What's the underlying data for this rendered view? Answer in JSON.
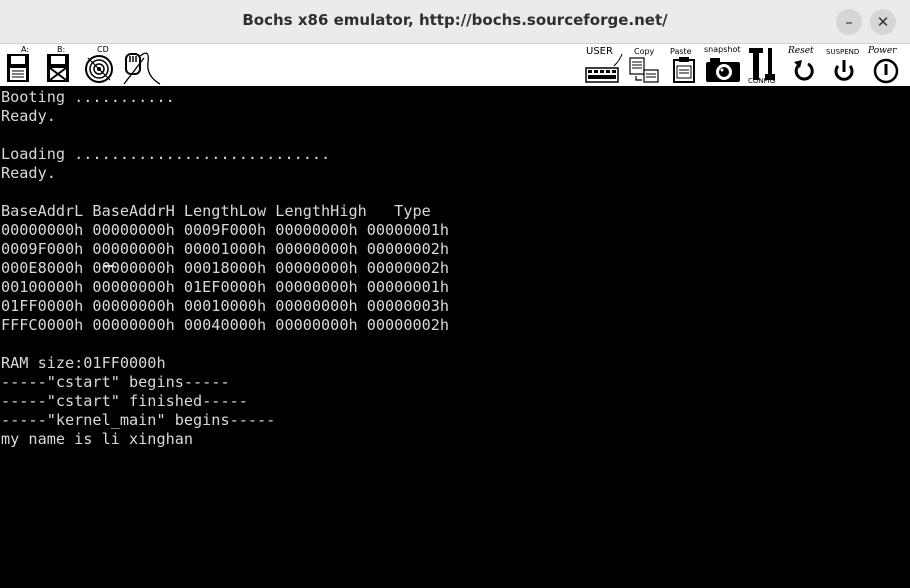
{
  "window": {
    "title": "Bochs x86 emulator, http://bochs.sourceforge.net/",
    "minimize_symbol": "–",
    "close_symbol": "✕"
  },
  "toolbar": {
    "floppy_a": "A:",
    "floppy_b": "B:",
    "cdrom": "CD",
    "user": "USER",
    "copy": "Copy",
    "paste": "Paste",
    "snapshot": "snapshot",
    "config": "CONFIG",
    "reset": "Reset",
    "suspend": "SUSPEND",
    "power": "Power",
    "icons": [
      "floppy-a-icon",
      "floppy-b-icon",
      "cdrom-icon",
      "mouse-icon",
      "keyboard-icon",
      "copy-icon",
      "paste-icon",
      "snapshot-camera-icon",
      "config-icon",
      "reset-icon",
      "suspend-icon",
      "power-icon"
    ]
  },
  "console": {
    "lines": [
      "Booting ...........",
      "Ready.",
      "",
      "Loading ............................",
      "Ready.",
      "",
      "BaseAddrL BaseAddrH LengthLow LengthHigh   Type",
      "00000000h 00000000h 0009F000h 00000000h 00000001h",
      "0009F000h 00000000h 00001000h 00000000h 00000002h",
      "000E8000h 00000000h 00018000h 00000000h 00000002h",
      "00100000h 00000000h 01EF0000h 00000000h 00000001h",
      "01FF0000h 00000000h 00010000h 00000000h 00000003h",
      "FFFC0000h 00000000h 00040000h 00000000h 00000002h",
      "",
      "RAM size:01FF0000h",
      "-----\"cstart\" begins-----",
      "-----\"cstart\" finished-----",
      "-----\"kernel_main\" begins-----",
      "my name is li xinghan"
    ]
  },
  "colors": {
    "screen_bg": "#000000",
    "screen_text": "#d9d9d9",
    "titlebar_bg": "#ebebeb",
    "toolbar_bg": "#ffffff"
  }
}
